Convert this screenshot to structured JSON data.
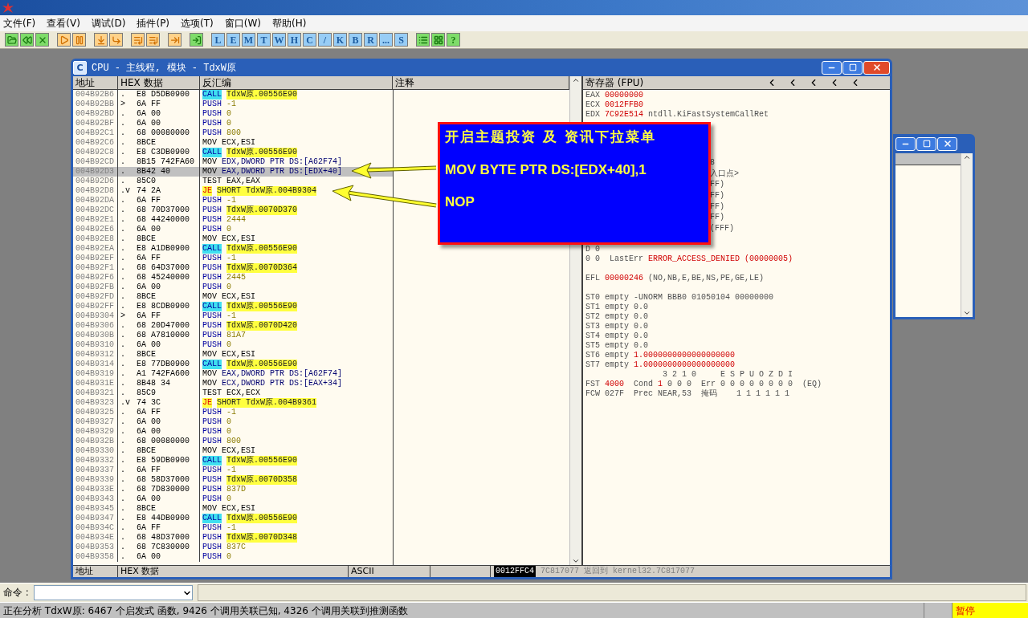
{
  "menu": [
    "文件(F)",
    "查看(V)",
    "调试(D)",
    "插件(P)",
    "选项(T)",
    "窗口(W)",
    "帮助(H)"
  ],
  "toolbar": {
    "letters": [
      "L",
      "E",
      "M",
      "T",
      "W",
      "H",
      "C",
      "/",
      "K",
      "B",
      "R",
      "...",
      "S"
    ],
    "help": "?"
  },
  "cpu_window": {
    "icon_letter": "C",
    "title": "CPU - 主线程, 模块 - TdxW原",
    "disassembly": {
      "columns": [
        "地址",
        "HEX 数据",
        "反汇编",
        "注释"
      ],
      "rows": [
        {
          "address": "004B92B6",
          "marker": ".",
          "hex": "E8 D5DB0900",
          "mnemonic": {
            "text": "CALL",
            "kind": "call"
          },
          "operand": {
            "text": "TdxW原.00556E90",
            "kind": "symbol"
          },
          "selected": false
        },
        {
          "address": "004B92BB",
          "marker": ">",
          "hex": "6A FF",
          "mnemonic": {
            "text": "PUSH",
            "kind": "push"
          },
          "operand": {
            "text": "-1",
            "kind": "number"
          },
          "selected": false
        },
        {
          "address": "004B92BD",
          "marker": ".",
          "hex": "6A 00",
          "mnemonic": {
            "text": "PUSH",
            "kind": "push"
          },
          "operand": {
            "text": "0",
            "kind": "number"
          },
          "selected": false
        },
        {
          "address": "004B92BF",
          "marker": ".",
          "hex": "6A 00",
          "mnemonic": {
            "text": "PUSH",
            "kind": "push"
          },
          "operand": {
            "text": "0",
            "kind": "number"
          },
          "selected": false
        },
        {
          "address": "004B92C1",
          "marker": ".",
          "hex": "68 00080000",
          "mnemonic": {
            "text": "PUSH",
            "kind": "push"
          },
          "operand": {
            "text": "800",
            "kind": "number"
          },
          "selected": false
        },
        {
          "address": "004B92C6",
          "marker": ".",
          "hex": "8BCE",
          "mnemonic": {
            "text": "MOV",
            "kind": "plain"
          },
          "operand": {
            "text": "ECX,ESI",
            "kind": "plain"
          },
          "selected": false
        },
        {
          "address": "004B92C8",
          "marker": ".",
          "hex": "E8 C3DB0900",
          "mnemonic": {
            "text": "CALL",
            "kind": "call"
          },
          "operand": {
            "text": "TdxW原.00556E90",
            "kind": "symbol"
          },
          "selected": false
        },
        {
          "address": "004B92CD",
          "marker": ".",
          "hex": "8B15 742FA60",
          "mnemonic": {
            "text": "MOV",
            "kind": "plain"
          },
          "operand": {
            "text": "EDX,DWORD PTR DS:[A62F74]",
            "kind": "memory"
          },
          "selected": false
        },
        {
          "address": "004B92D3",
          "marker": ".",
          "hex": "8B42 40",
          "mnemonic": {
            "text": "MOV",
            "kind": "plain"
          },
          "operand": {
            "text": "EAX,DWORD PTR DS:[EDX+40]",
            "kind": "memory"
          },
          "selected": true
        },
        {
          "address": "004B92D6",
          "marker": ".",
          "hex": "85C0",
          "mnemonic": {
            "text": "TEST",
            "kind": "plain"
          },
          "operand": {
            "text": "EAX,EAX",
            "kind": "plain"
          },
          "selected": false
        },
        {
          "address": "004B92D8",
          "marker": ".v",
          "hex": "74 2A",
          "mnemonic": {
            "text": "JE",
            "kind": "jump"
          },
          "operand": {
            "text": "SHORT TdxW原.004B9304",
            "kind": "symbol"
          },
          "selected": false
        },
        {
          "address": "004B92DA",
          "marker": ".",
          "hex": "6A FF",
          "mnemonic": {
            "text": "PUSH",
            "kind": "push"
          },
          "operand": {
            "text": "-1",
            "kind": "number"
          },
          "selected": false
        },
        {
          "address": "004B92DC",
          "marker": ".",
          "hex": "68 70D37000",
          "mnemonic": {
            "text": "PUSH",
            "kind": "push"
          },
          "operand": {
            "text": "TdxW原.0070D370",
            "kind": "symbol"
          },
          "selected": false
        },
        {
          "address": "004B92E1",
          "marker": ".",
          "hex": "68 44240000",
          "mnemonic": {
            "text": "PUSH",
            "kind": "push"
          },
          "operand": {
            "text": "2444",
            "kind": "number"
          },
          "selected": false
        },
        {
          "address": "004B92E6",
          "marker": ".",
          "hex": "6A 00",
          "mnemonic": {
            "text": "PUSH",
            "kind": "push"
          },
          "operand": {
            "text": "0",
            "kind": "number"
          },
          "selected": false
        },
        {
          "address": "004B92E8",
          "marker": ".",
          "hex": "8BCE",
          "mnemonic": {
            "text": "MOV",
            "kind": "plain"
          },
          "operand": {
            "text": "ECX,ESI",
            "kind": "plain"
          },
          "selected": false
        },
        {
          "address": "004B92EA",
          "marker": ".",
          "hex": "E8 A1DB0900",
          "mnemonic": {
            "text": "CALL",
            "kind": "call"
          },
          "operand": {
            "text": "TdxW原.00556E90",
            "kind": "symbol"
          },
          "selected": false
        },
        {
          "address": "004B92EF",
          "marker": ".",
          "hex": "6A FF",
          "mnemonic": {
            "text": "PUSH",
            "kind": "push"
          },
          "operand": {
            "text": "-1",
            "kind": "number"
          },
          "selected": false
        },
        {
          "address": "004B92F1",
          "marker": ".",
          "hex": "68 64D37000",
          "mnemonic": {
            "text": "PUSH",
            "kind": "push"
          },
          "operand": {
            "text": "TdxW原.0070D364",
            "kind": "symbol"
          },
          "selected": false
        },
        {
          "address": "004B92F6",
          "marker": ".",
          "hex": "68 45240000",
          "mnemonic": {
            "text": "PUSH",
            "kind": "push"
          },
          "operand": {
            "text": "2445",
            "kind": "number"
          },
          "selected": false
        },
        {
          "address": "004B92FB",
          "marker": ".",
          "hex": "6A 00",
          "mnemonic": {
            "text": "PUSH",
            "kind": "push"
          },
          "operand": {
            "text": "0",
            "kind": "number"
          },
          "selected": false
        },
        {
          "address": "004B92FD",
          "marker": ".",
          "hex": "8BCE",
          "mnemonic": {
            "text": "MOV",
            "kind": "plain"
          },
          "operand": {
            "text": "ECX,ESI",
            "kind": "plain"
          },
          "selected": false
        },
        {
          "address": "004B92FF",
          "marker": ".",
          "hex": "E8 8CDB0900",
          "mnemonic": {
            "text": "CALL",
            "kind": "call"
          },
          "operand": {
            "text": "TdxW原.00556E90",
            "kind": "symbol"
          },
          "selected": false
        },
        {
          "address": "004B9304",
          "marker": ">",
          "hex": "6A FF",
          "mnemonic": {
            "text": "PUSH",
            "kind": "push"
          },
          "operand": {
            "text": "-1",
            "kind": "number"
          },
          "selected": false
        },
        {
          "address": "004B9306",
          "marker": ".",
          "hex": "68 20D47000",
          "mnemonic": {
            "text": "PUSH",
            "kind": "push"
          },
          "operand": {
            "text": "TdxW原.0070D420",
            "kind": "symbol"
          },
          "selected": false
        },
        {
          "address": "004B930B",
          "marker": ".",
          "hex": "68 A7810000",
          "mnemonic": {
            "text": "PUSH",
            "kind": "push"
          },
          "operand": {
            "text": "81A7",
            "kind": "number"
          },
          "selected": false
        },
        {
          "address": "004B9310",
          "marker": ".",
          "hex": "6A 00",
          "mnemonic": {
            "text": "PUSH",
            "kind": "push"
          },
          "operand": {
            "text": "0",
            "kind": "number"
          },
          "selected": false
        },
        {
          "address": "004B9312",
          "marker": ".",
          "hex": "8BCE",
          "mnemonic": {
            "text": "MOV",
            "kind": "plain"
          },
          "operand": {
            "text": "ECX,ESI",
            "kind": "plain"
          },
          "selected": false
        },
        {
          "address": "004B9314",
          "marker": ".",
          "hex": "E8 77DB0900",
          "mnemonic": {
            "text": "CALL",
            "kind": "call"
          },
          "operand": {
            "text": "TdxW原.00556E90",
            "kind": "symbol"
          },
          "selected": false
        },
        {
          "address": "004B9319",
          "marker": ".",
          "hex": "A1 742FA600",
          "mnemonic": {
            "text": "MOV",
            "kind": "plain"
          },
          "operand": {
            "text": "EAX,DWORD PTR DS:[A62F74]",
            "kind": "memory"
          },
          "selected": false
        },
        {
          "address": "004B931E",
          "marker": ".",
          "hex": "8B48 34",
          "mnemonic": {
            "text": "MOV",
            "kind": "plain"
          },
          "operand": {
            "text": "ECX,DWORD PTR DS:[EAX+34]",
            "kind": "memory"
          },
          "selected": false
        },
        {
          "address": "004B9321",
          "marker": ".",
          "hex": "85C9",
          "mnemonic": {
            "text": "TEST",
            "kind": "plain"
          },
          "operand": {
            "text": "ECX,ECX",
            "kind": "plain"
          },
          "selected": false
        },
        {
          "address": "004B9323",
          "marker": ".v",
          "hex": "74 3C",
          "mnemonic": {
            "text": "JE",
            "kind": "jump"
          },
          "operand": {
            "text": "SHORT TdxW原.004B9361",
            "kind": "symbol"
          },
          "selected": false
        },
        {
          "address": "004B9325",
          "marker": ".",
          "hex": "6A FF",
          "mnemonic": {
            "text": "PUSH",
            "kind": "push"
          },
          "operand": {
            "text": "-1",
            "kind": "number"
          },
          "selected": false
        },
        {
          "address": "004B9327",
          "marker": ".",
          "hex": "6A 00",
          "mnemonic": {
            "text": "PUSH",
            "kind": "push"
          },
          "operand": {
            "text": "0",
            "kind": "number"
          },
          "selected": false
        },
        {
          "address": "004B9329",
          "marker": ".",
          "hex": "6A 00",
          "mnemonic": {
            "text": "PUSH",
            "kind": "push"
          },
          "operand": {
            "text": "0",
            "kind": "number"
          },
          "selected": false
        },
        {
          "address": "004B932B",
          "marker": ".",
          "hex": "68 00080000",
          "mnemonic": {
            "text": "PUSH",
            "kind": "push"
          },
          "operand": {
            "text": "800",
            "kind": "number"
          },
          "selected": false
        },
        {
          "address": "004B9330",
          "marker": ".",
          "hex": "8BCE",
          "mnemonic": {
            "text": "MOV",
            "kind": "plain"
          },
          "operand": {
            "text": "ECX,ESI",
            "kind": "plain"
          },
          "selected": false
        },
        {
          "address": "004B9332",
          "marker": ".",
          "hex": "E8 59DB0900",
          "mnemonic": {
            "text": "CALL",
            "kind": "call"
          },
          "operand": {
            "text": "TdxW原.00556E90",
            "kind": "symbol"
          },
          "selected": false
        },
        {
          "address": "004B9337",
          "marker": ".",
          "hex": "6A FF",
          "mnemonic": {
            "text": "PUSH",
            "kind": "push"
          },
          "operand": {
            "text": "-1",
            "kind": "number"
          },
          "selected": false
        },
        {
          "address": "004B9339",
          "marker": ".",
          "hex": "68 58D37000",
          "mnemonic": {
            "text": "PUSH",
            "kind": "push"
          },
          "operand": {
            "text": "TdxW原.0070D358",
            "kind": "symbol"
          },
          "selected": false
        },
        {
          "address": "004B933E",
          "marker": ".",
          "hex": "68 7D830000",
          "mnemonic": {
            "text": "PUSH",
            "kind": "push"
          },
          "operand": {
            "text": "837D",
            "kind": "number"
          },
          "selected": false
        },
        {
          "address": "004B9343",
          "marker": ".",
          "hex": "6A 00",
          "mnemonic": {
            "text": "PUSH",
            "kind": "push"
          },
          "operand": {
            "text": "0",
            "kind": "number"
          },
          "selected": false
        },
        {
          "address": "004B9345",
          "marker": ".",
          "hex": "8BCE",
          "mnemonic": {
            "text": "MOV",
            "kind": "plain"
          },
          "operand": {
            "text": "ECX,ESI",
            "kind": "plain"
          },
          "selected": false
        },
        {
          "address": "004B9347",
          "marker": ".",
          "hex": "E8 44DB0900",
          "mnemonic": {
            "text": "CALL",
            "kind": "call"
          },
          "operand": {
            "text": "TdxW原.00556E90",
            "kind": "symbol"
          },
          "selected": false
        },
        {
          "address": "004B934C",
          "marker": ".",
          "hex": "6A FF",
          "mnemonic": {
            "text": "PUSH",
            "kind": "push"
          },
          "operand": {
            "text": "-1",
            "kind": "number"
          },
          "selected": false
        },
        {
          "address": "004B934E",
          "marker": ".",
          "hex": "68 48D37000",
          "mnemonic": {
            "text": "PUSH",
            "kind": "push"
          },
          "operand": {
            "text": "TdxW原.0070D348",
            "kind": "symbol"
          },
          "selected": false
        },
        {
          "address": "004B9353",
          "marker": ".",
          "hex": "68 7C830000",
          "mnemonic": {
            "text": "PUSH",
            "kind": "push"
          },
          "operand": {
            "text": "837C",
            "kind": "number"
          },
          "selected": false
        },
        {
          "address": "004B9358",
          "marker": ".",
          "hex": "6A 00",
          "mnemonic": {
            "text": "PUSH",
            "kind": "push"
          },
          "operand": {
            "text": "0",
            "kind": "number"
          },
          "selected": false
        }
      ]
    },
    "registers": {
      "title": "寄存器 (FPU)",
      "groups": [
        {
          "kind": "plain",
          "lines": [
            {
              "kind": "text",
              "parts": [
                {
                  "text": "EAX",
                  "kind": "label"
                },
                {
                  "text": "00000000",
                  "kind": "value"
                }
              ]
            },
            {
              "kind": "text",
              "parts": [
                {
                  "text": "ECX",
                  "kind": "label"
                },
                {
                  "text": "0012FFB0",
                  "kind": "value"
                }
              ]
            },
            {
              "kind": "text",
              "parts": [
                {
                  "text": "EDX",
                  "kind": "label"
                },
                {
                  "text": "7C92E514",
                  "kind": "value"
                },
                {
                  "text": "ntdll.KiFastSystemCallRet",
                  "kind": "label"
                }
              ]
            }
          ]
        },
        {
          "kind": "tail",
          "lines": [
            {
              "kind": "text",
              "parts": [
                {
                  "text": "8",
                  "kind": "label"
                }
              ]
            },
            {
              "kind": "text",
              "parts": [
                {
                  "text": "入口点>",
                  "kind": "label"
                }
              ]
            },
            {
              "kind": "text",
              "parts": [
                {
                  "text": "FF)",
                  "kind": "label"
                }
              ]
            },
            {
              "kind": "text",
              "parts": [
                {
                  "text": "FF)",
                  "kind": "label"
                }
              ]
            },
            {
              "kind": "text",
              "parts": [
                {
                  "text": "FF)",
                  "kind": "label"
                }
              ]
            },
            {
              "kind": "text",
              "parts": [
                {
                  "text": "FF)",
                  "kind": "label"
                }
              ]
            },
            {
              "kind": "text",
              "parts": [
                {
                  "text": "(FFF)",
                  "kind": "label"
                }
              ]
            }
          ]
        },
        {
          "kind": "plain",
          "lines": [
            {
              "kind": "text",
              "parts": [
                {
                  "text": "D 0",
                  "kind": "label"
                }
              ]
            },
            {
              "kind": "text",
              "parts": [
                {
                  "text": "0 0  LastErr",
                  "kind": "label"
                },
                {
                  "text": "ERROR_ACCESS_DENIED (00000005)",
                  "kind": "value"
                }
              ]
            }
          ]
        },
        {
          "kind": "plain",
          "lines": [
            {
              "kind": "text",
              "parts": [
                {
                  "text": "EFL",
                  "kind": "label"
                },
                {
                  "text": "00000246",
                  "kind": "value"
                },
                {
                  "text": "(NO,NB,E,BE,NS,PE,GE,LE)",
                  "kind": "label"
                }
              ]
            }
          ]
        },
        {
          "kind": "plain",
          "lines": [
            {
              "kind": "text",
              "parts": [
                {
                  "text": "ST0 empty -UNORM BBB0 01050104 00000000",
                  "kind": "label"
                }
              ]
            },
            {
              "kind": "text",
              "parts": [
                {
                  "text": "ST1 empty 0.0",
                  "kind": "label"
                }
              ]
            },
            {
              "kind": "text",
              "parts": [
                {
                  "text": "ST2 empty 0.0",
                  "kind": "label"
                }
              ]
            },
            {
              "kind": "text",
              "parts": [
                {
                  "text": "ST3 empty 0.0",
                  "kind": "label"
                }
              ]
            },
            {
              "kind": "text",
              "parts": [
                {
                  "text": "ST4 empty 0.0",
                  "kind": "label"
                }
              ]
            },
            {
              "kind": "text",
              "parts": [
                {
                  "text": "ST5 empty 0.0",
                  "kind": "label"
                }
              ]
            },
            {
              "kind": "text",
              "parts": [
                {
                  "text": "ST6 empty",
                  "kind": "label"
                },
                {
                  "text": "1.0000000000000000000",
                  "kind": "value"
                }
              ]
            },
            {
              "kind": "text",
              "parts": [
                {
                  "text": "ST7 empty",
                  "kind": "label"
                },
                {
                  "text": "1.0000000000000000000",
                  "kind": "value"
                }
              ]
            },
            {
              "kind": "flag_header",
              "parts": [
                {
                  "text": "3 2 1 0     E S P U O Z D I",
                  "kind": "label"
                }
              ]
            },
            {
              "kind": "text",
              "parts": [
                {
                  "text": "FST",
                  "kind": "label"
                },
                {
                  "text": "4000",
                  "kind": "value"
                },
                {
                  "text": " Cond",
                  "kind": "label"
                },
                {
                  "text": "1",
                  "kind": "value"
                },
                {
                  "text": "0 0 0  Err 0 0 0 0 0 0 0 0  (EQ)",
                  "kind": "label"
                }
              ]
            },
            {
              "kind": "text",
              "parts": [
                {
                  "text": "FCW 027F  Prec NEAR,53  掩码    1 1 1 1 1 1",
                  "kind": "label"
                }
              ]
            }
          ]
        }
      ]
    },
    "dump": {
      "columns": [
        "地址",
        "HEX 数据",
        "ASCII"
      ]
    },
    "stack": {
      "address": "0012FFC4",
      "value": "7C817077",
      "comment": "返回到 kernel32.7C817077"
    }
  },
  "annotation": {
    "lines": [
      {
        "kind": "title",
        "text": "开启主题投资 及 资讯下拉菜单"
      },
      {
        "kind": "code",
        "text": "MOV BYTE PTR DS:[EDX+40],1"
      },
      {
        "kind": "code",
        "text": "NOP"
      }
    ]
  },
  "command": {
    "label": "命令 :"
  },
  "status": {
    "message": "正在分析 TdxW原: 6467 个启发式 函数, 9426 个调用关联已知, 4326 个调用关联到推测函数",
    "state": "暂停"
  }
}
